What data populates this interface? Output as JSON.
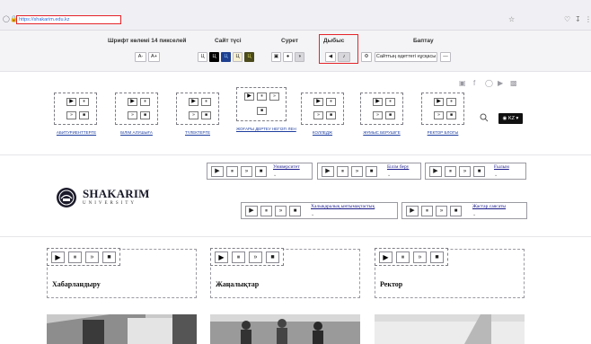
{
  "browser": {
    "url": "https://shakarim.edu.kz",
    "icons": [
      "shield-icon",
      "lock-icon",
      "star-icon",
      "pocket-icon",
      "download-icon",
      "menu-icon"
    ]
  },
  "accessibility": {
    "font_size_label": "Шрифт көлемі 14 пикселей",
    "font_decrease": "A-",
    "font_increase": "A+",
    "site_color_label": "Сайт түсі",
    "color_letter": "Ц",
    "image_label": "Сурет",
    "sound_label": "Дыбыс",
    "settings_label": "Баптау",
    "regular_site_label": "Сайттың әдеттегі нұсқасы",
    "minus_label": "—"
  },
  "nav": {
    "items": [
      {
        "label": "АБИТУРИЕНТТЕРГЕ"
      },
      {
        "label": "БІЛІМ АЛУШЫҒА"
      },
      {
        "label": "ТҮЛЕКТЕРГЕ"
      },
      {
        "label": "ЖОҒАРЫ ДЕРТЕУ НЕГІЗГІ ЛЕН",
        "label2": "НЕГІЗГІ ЛЕН"
      },
      {
        "label": "КОЛЛЕДЖ"
      },
      {
        "label": "ЖҰМЫС БЕРУШІГЕ"
      },
      {
        "label": "РЕКТОР БЛОГЫ"
      }
    ],
    "lang": "KZ"
  },
  "logo": {
    "main": "SHAKARIM",
    "sub": "UNIVERSITY"
  },
  "menu_row1": [
    {
      "label": "Университет"
    },
    {
      "label": "Білім беру"
    },
    {
      "label": "Ғылым"
    }
  ],
  "menu_row2": [
    {
      "label": "Халықаралық ынтымақтастық"
    },
    {
      "label": "Жастар саясаты"
    }
  ],
  "cards": [
    {
      "title": "Хабарландыру"
    },
    {
      "title": "Жаңалықтар"
    },
    {
      "title": "Ректор"
    }
  ],
  "glyphs": {
    "play": "▶",
    "pause": "⏸",
    "forward": "»",
    "stop": "■",
    "chevron": "⌄",
    "gear": "⚙",
    "back": "◀",
    "sound": "🔊"
  },
  "colors": {
    "highlight_border": "#e5242a",
    "nav_link": "#1e3e9f"
  }
}
